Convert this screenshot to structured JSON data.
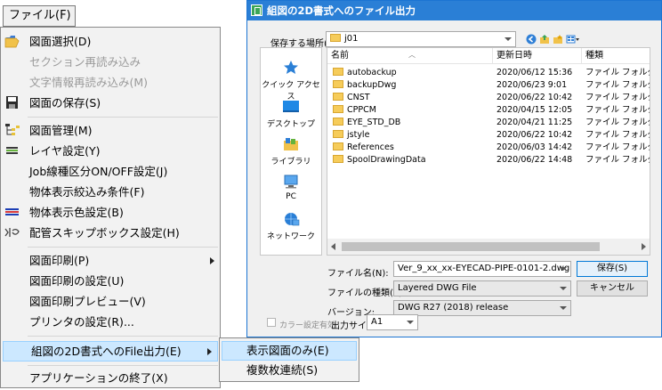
{
  "menu": {
    "title": "ファイル(F)",
    "items": [
      {
        "label": "図面選択(D)",
        "disabled": false,
        "icon": "folder-open-icon"
      },
      {
        "label": "セクション再読み込み",
        "disabled": true,
        "icon": ""
      },
      {
        "label": "文字情報再読み込み(M)",
        "disabled": true,
        "icon": ""
      },
      {
        "label": "図面の保存(S)",
        "disabled": false,
        "icon": "floppy-disk-icon"
      },
      {
        "label": "図面管理(M)",
        "disabled": false,
        "icon": "tree-manage-icon"
      },
      {
        "label": "レイヤ設定(Y)",
        "disabled": false,
        "icon": "layers-icon"
      },
      {
        "label": "Job線種区分ON/OFF設定(J)",
        "disabled": false,
        "icon": ""
      },
      {
        "label": "物体表示絞込み条件(F)",
        "disabled": false,
        "icon": ""
      },
      {
        "label": "物体表示色設定(B)",
        "disabled": false,
        "icon": "color-lines-icon"
      },
      {
        "label": "配管スキップボックス設定(H)",
        "disabled": false,
        "icon": "skip-box-icon"
      },
      {
        "label": "図面印刷(P)",
        "disabled": false,
        "icon": ""
      },
      {
        "label": "図面印刷の設定(U)",
        "disabled": false,
        "icon": ""
      },
      {
        "label": "図面印刷プレビュー(V)",
        "disabled": false,
        "icon": ""
      },
      {
        "label": "プリンタの設定(R)...",
        "disabled": false,
        "icon": ""
      },
      {
        "label": "組図の2D書式へのFile出力(E)",
        "disabled": false,
        "icon": ""
      },
      {
        "label": "アプリケーションの終了(X)",
        "disabled": false,
        "icon": ""
      }
    ]
  },
  "submenu": {
    "items": [
      {
        "label": "表示図面のみ(E)"
      },
      {
        "label": "複数枚連続(S)"
      }
    ]
  },
  "dialog": {
    "title": "組図の2D書式へのファイル出力",
    "save_in_label": "保存する場所(I):",
    "save_in_value": "j01",
    "places": [
      {
        "label": "クイック アクセス",
        "icon": "star-icon"
      },
      {
        "label": "デスクトップ",
        "icon": "desktop-icon"
      },
      {
        "label": "ライブラリ",
        "icon": "library-icon"
      },
      {
        "label": "PC",
        "icon": "pc-icon"
      },
      {
        "label": "ネットワーク",
        "icon": "network-icon"
      }
    ],
    "columns": [
      "名前",
      "更新日時",
      "種類"
    ],
    "files": [
      {
        "name": "autobackup",
        "date": "2020/06/12 15:36",
        "type": "ファイル フォルダー"
      },
      {
        "name": "backupDwg",
        "date": "2020/06/23 9:01",
        "type": "ファイル フォルダー"
      },
      {
        "name": "CNST",
        "date": "2020/06/22 10:42",
        "type": "ファイル フォルダー"
      },
      {
        "name": "CPPCM",
        "date": "2020/04/15 12:05",
        "type": "ファイル フォルダー"
      },
      {
        "name": "EYE_STD_DB",
        "date": "2020/04/21 11:25",
        "type": "ファイル フォルダー"
      },
      {
        "name": "jstyle",
        "date": "2020/06/22 10:42",
        "type": "ファイル フォルダー"
      },
      {
        "name": "References",
        "date": "2020/06/03 14:42",
        "type": "ファイル フォルダー"
      },
      {
        "name": "SpoolDrawingData",
        "date": "2020/06/22 14:48",
        "type": "ファイル フォルダー"
      }
    ],
    "filename_label": "ファイル名(N):",
    "filename_value": "Ver_9_xx_xx-EYECAD-PIPE-0101-2.dwg",
    "filetype_label": "ファイルの種類(T):",
    "filetype_value": "Layered DWG File",
    "version_label": "バージョン:",
    "version_value": "DWG R27 (2018) release",
    "color_setting_label": "カラー設定有効",
    "output_size_label": "出力サイズ:",
    "output_size_value": "A1",
    "save_button": "保存(S)",
    "cancel_button": "キャンセル"
  }
}
